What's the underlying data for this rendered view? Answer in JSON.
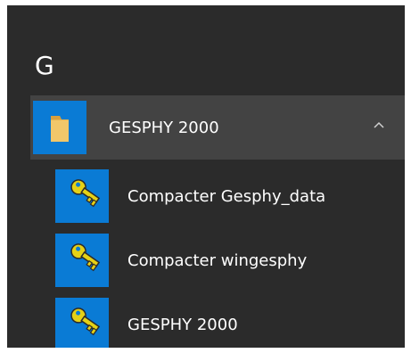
{
  "start_menu": {
    "letter_header": "G",
    "folder": {
      "label": "GESPHY 2000",
      "icon": "folder-icon",
      "expanded": true,
      "toggle_icon": "chevron-up-icon"
    },
    "items": [
      {
        "label": "Compacter Gesphy_data",
        "icon": "key-icon"
      },
      {
        "label": "Compacter wingesphy",
        "icon": "key-icon"
      },
      {
        "label": "GESPHY 2000",
        "icon": "key-icon"
      }
    ]
  },
  "colors": {
    "panel_bg": "#2b2b2b",
    "folder_row_bg": "#434343",
    "tile_blue": "#0a7bd5",
    "folder_yellow": "#f1c76a",
    "key_yellow": "#e5d116",
    "text": "#ffffff"
  }
}
